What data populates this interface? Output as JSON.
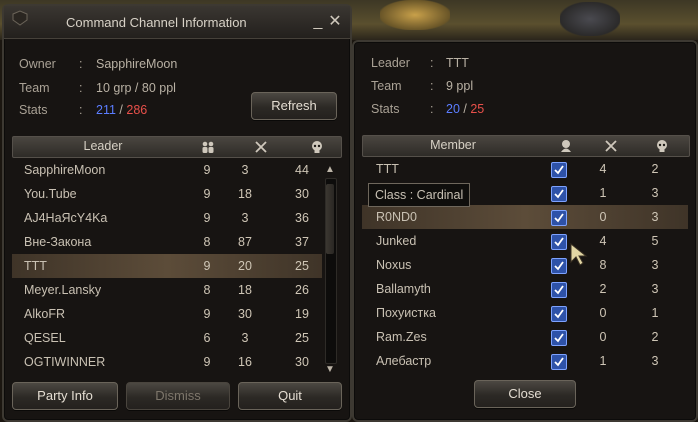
{
  "left": {
    "title": "Command Channel Information",
    "owner_label": "Owner",
    "owner": "SapphireMoon",
    "team_label": "Team",
    "team": "10 grp / 80 ppl",
    "stats_label": "Stats",
    "stats_a": "211",
    "stats_slash": "/",
    "stats_b": "286",
    "refresh": "Refresh",
    "column_leader": "Leader",
    "rows": [
      {
        "name": "SapphireMoon",
        "c1": "9",
        "c2": "3",
        "c3": "44"
      },
      {
        "name": "You.Tube",
        "c1": "9",
        "c2": "18",
        "c3": "30"
      },
      {
        "name": "AJ4HaЯcY4Ka",
        "c1": "9",
        "c2": "3",
        "c3": "36"
      },
      {
        "name": "Вне-Закона",
        "c1": "8",
        "c2": "87",
        "c3": "37"
      },
      {
        "name": "TTT",
        "c1": "9",
        "c2": "20",
        "c3": "25"
      },
      {
        "name": "Meyer.Lansky",
        "c1": "8",
        "c2": "18",
        "c3": "26"
      },
      {
        "name": "AlkoFR",
        "c1": "9",
        "c2": "30",
        "c3": "19"
      },
      {
        "name": "QESEL",
        "c1": "6",
        "c2": "3",
        "c3": "25"
      },
      {
        "name": "OGTIWINNER",
        "c1": "9",
        "c2": "16",
        "c3": "30"
      }
    ],
    "selected_row": 4,
    "buttons": {
      "party_info": "Party Info",
      "dismiss": "Dismiss",
      "quit": "Quit"
    }
  },
  "right": {
    "leader_label": "Leader",
    "leader": "TTT",
    "team_label": "Team",
    "team": "9 ppl",
    "stats_label": "Stats",
    "stats_a": "20",
    "stats_slash": "/",
    "stats_b": "25",
    "column_member": "Member",
    "rows": [
      {
        "name": "TTT",
        "c2": "4",
        "c3": "2"
      },
      {
        "name": "",
        "c2": "1",
        "c3": "3"
      },
      {
        "name": "R0ND0",
        "c2": "0",
        "c3": "3"
      },
      {
        "name": "Junked",
        "c2": "4",
        "c3": "5"
      },
      {
        "name": "Noxus",
        "c2": "8",
        "c3": "3"
      },
      {
        "name": "Ballamyth",
        "c2": "2",
        "c3": "3"
      },
      {
        "name": "Похуистка",
        "c2": "0",
        "c3": "1"
      },
      {
        "name": "Ram.Zes",
        "c2": "0",
        "c3": "2"
      },
      {
        "name": "Алебастр",
        "c2": "1",
        "c3": "3"
      }
    ],
    "hovered_row": 2,
    "tooltip": "Class : Cardinal",
    "close": "Close"
  },
  "colors": {
    "stat_blue": "#5b7dff",
    "stat_red": "#e8504a",
    "selected_row": "#5c4c39"
  }
}
